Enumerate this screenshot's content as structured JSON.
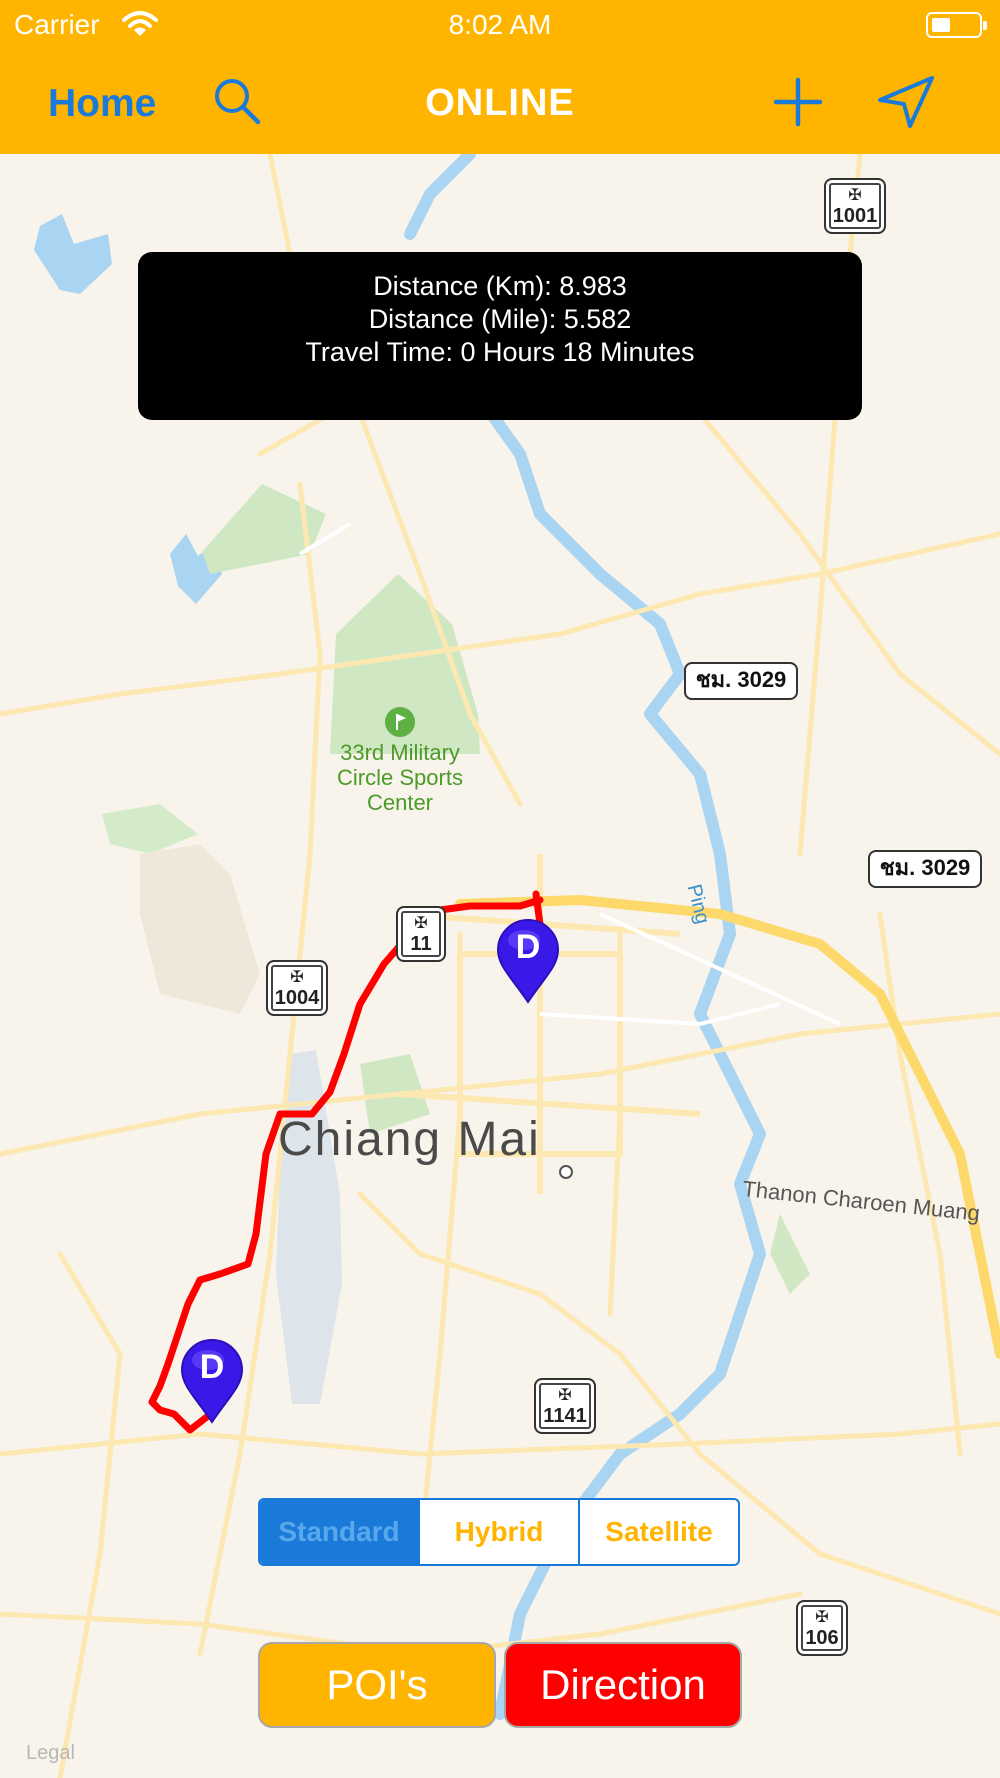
{
  "status_bar": {
    "carrier": "Carrier",
    "time": "8:02 AM"
  },
  "nav_bar": {
    "home_label": "Home",
    "title": "ONLINE"
  },
  "info": {
    "distance_km": "Distance (Km): 8.983",
    "distance_mile": "Distance (Mile): 5.582",
    "travel_time": "Travel Time: 0 Hours 18 Minutes"
  },
  "map": {
    "city_label": "Chiang Mai",
    "park_label": "33rd Military Circle Sports Center",
    "river_label": "Ping",
    "street_label": "Thanon Charoen Muang",
    "legal_label": "Legal",
    "route_badges": [
      "ชม. 3029",
      "ชม. 3029"
    ],
    "highway_shields": [
      "1001",
      "1004",
      "11",
      "1141",
      "106"
    ],
    "pins": [
      "D",
      "D"
    ]
  },
  "map_types": {
    "options": [
      "Standard",
      "Hybrid",
      "Satellite"
    ],
    "selected": "Standard"
  },
  "buttons": {
    "poi_label": "POI's",
    "direction_label": "Direction"
  },
  "colors": {
    "accent": "#ffb400",
    "blue": "#1a7ad9",
    "route": "#ff0000",
    "pin": "#3a18e8"
  }
}
